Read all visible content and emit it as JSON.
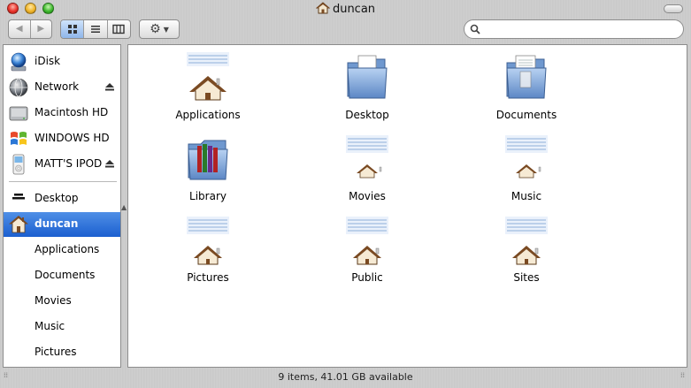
{
  "window": {
    "title": "duncan"
  },
  "search": {
    "value": "",
    "placeholder": ""
  },
  "sidebar": {
    "devices": [
      {
        "label": "iDisk",
        "icon": "idisk-icon",
        "eject": false
      },
      {
        "label": "Network",
        "icon": "network-globe-icon",
        "eject": true
      },
      {
        "label": "Macintosh HD",
        "icon": "hard-drive-icon",
        "eject": false
      },
      {
        "label": "WINDOWS HD",
        "icon": "windows-drive-icon",
        "eject": false
      },
      {
        "label": "MATT'S IPOD",
        "icon": "ipod-icon",
        "eject": true
      }
    ],
    "places": [
      {
        "label": "Desktop",
        "icon": "desktop-icon",
        "selected": false
      },
      {
        "label": "duncan",
        "icon": "home-icon",
        "selected": true
      },
      {
        "label": "Applications",
        "icon": "",
        "selected": false
      },
      {
        "label": "Documents",
        "icon": "",
        "selected": false
      },
      {
        "label": "Movies",
        "icon": "",
        "selected": false
      },
      {
        "label": "Music",
        "icon": "",
        "selected": false
      },
      {
        "label": "Pictures",
        "icon": "",
        "selected": false
      }
    ]
  },
  "items": [
    {
      "label": "Applications",
      "icon": "home-thumbnail-icon"
    },
    {
      "label": "Desktop",
      "icon": "folder-icon"
    },
    {
      "label": "Documents",
      "icon": "documents-folder-icon"
    },
    {
      "label": "Library",
      "icon": "library-folder-icon"
    },
    {
      "label": "Movies",
      "icon": "home-thumbnail-icon"
    },
    {
      "label": "Music",
      "icon": "home-thumbnail-icon"
    },
    {
      "label": "Pictures",
      "icon": "home-thumbnail-icon"
    },
    {
      "label": "Public",
      "icon": "home-thumbnail-icon"
    },
    {
      "label": "Sites",
      "icon": "home-thumbnail-icon"
    }
  ],
  "status": {
    "text": "9 items, 41.01 GB available"
  },
  "colors": {
    "selection": "#1b5fd0",
    "folder_blue": "#7fa6d8"
  }
}
